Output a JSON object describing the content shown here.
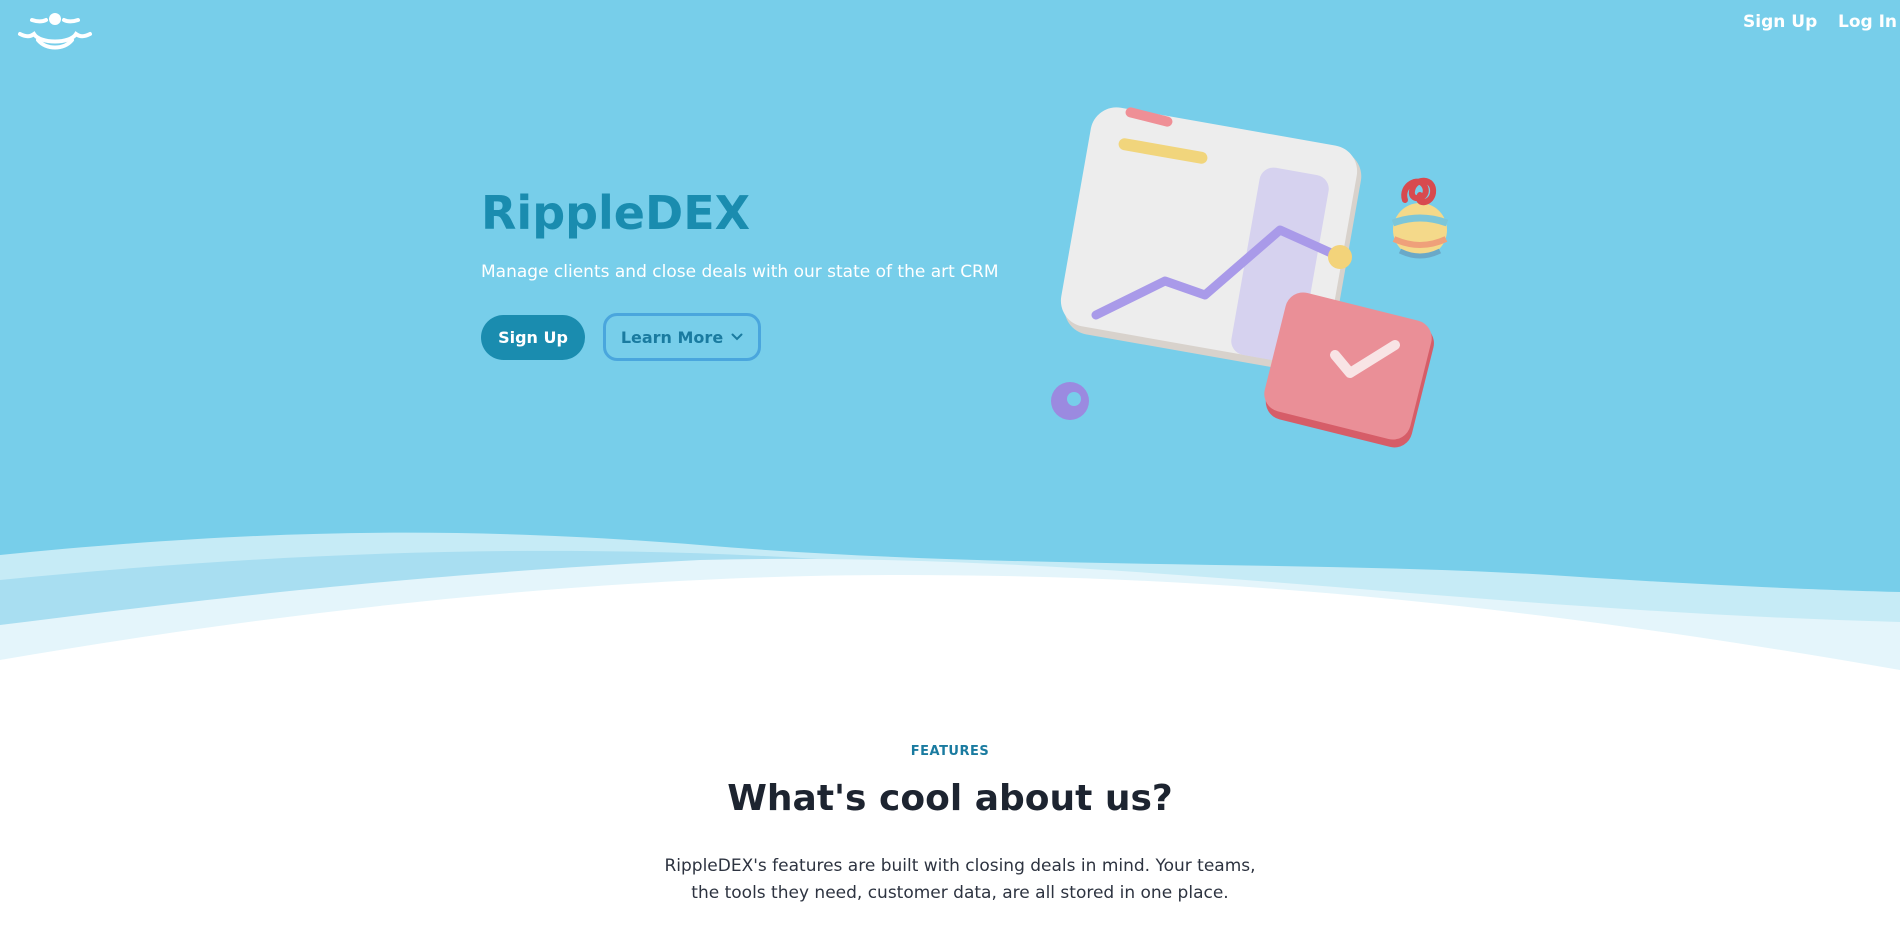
{
  "nav": {
    "logo_icon": "ripple-logo-icon",
    "signup_label": "Sign Up",
    "login_label": "Log In"
  },
  "hero": {
    "title": "RippleDEX",
    "subtitle": "Manage clients and close deals with our state of the art CRM",
    "signup_button": "Sign Up",
    "learn_more_button": "Learn More",
    "learn_more_icon": "chevron-down-icon",
    "illustration": "crm-chart-illustration"
  },
  "features": {
    "label": "FEATURES",
    "heading": "What's cool about us?",
    "description": "RippleDEX's features are built with closing deals in mind. Your teams, the tools they need, customer data, are all stored in one place."
  },
  "colors": {
    "hero_background": "#77ceea",
    "brand_primary": "#1a8caf",
    "button_outline": "#4aa6dd",
    "heading_text": "#1d2430",
    "body_text": "#2d3340"
  }
}
